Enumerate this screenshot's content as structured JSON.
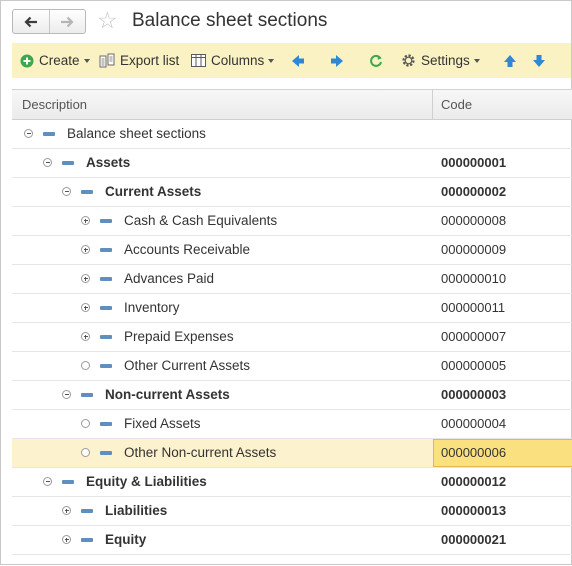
{
  "window": {
    "title": "Balance sheet sections"
  },
  "nav": {
    "back_icon": "arrow-left-icon",
    "forward_icon": "arrow-right-icon",
    "favorite_icon": "star-icon"
  },
  "toolbar": {
    "create_label": "Create",
    "export_label": "Export list",
    "columns_label": "Columns",
    "settings_label": "Settings",
    "colors": {
      "create": "#3aa84c",
      "arrows": "#2f87d6",
      "refresh": "#3aa84c"
    }
  },
  "table": {
    "columns": [
      "Description",
      "Code"
    ],
    "rows": [
      {
        "level": 0,
        "expander": "minus",
        "label": "Balance sheet sections",
        "code": "",
        "bold": false
      },
      {
        "level": 1,
        "expander": "minus",
        "label": "Assets",
        "code": "000000001",
        "bold": true
      },
      {
        "level": 2,
        "expander": "minus",
        "label": "Current Assets",
        "code": "000000002",
        "bold": true
      },
      {
        "level": 3,
        "expander": "plus",
        "label": "Cash & Cash Equivalents",
        "code": "000000008",
        "bold": false
      },
      {
        "level": 3,
        "expander": "plus",
        "label": "Accounts Receivable",
        "code": "000000009",
        "bold": false
      },
      {
        "level": 3,
        "expander": "plus",
        "label": "Advances Paid",
        "code": "000000010",
        "bold": false
      },
      {
        "level": 3,
        "expander": "plus",
        "label": "Inventory",
        "code": "000000011",
        "bold": false
      },
      {
        "level": 3,
        "expander": "plus",
        "label": "Prepaid Expenses",
        "code": "000000007",
        "bold": false
      },
      {
        "level": 3,
        "expander": "leaf",
        "label": "Other Current Assets",
        "code": "000000005",
        "bold": false
      },
      {
        "level": 2,
        "expander": "minus",
        "label": "Non-current Assets",
        "code": "000000003",
        "bold": true
      },
      {
        "level": 3,
        "expander": "leaf",
        "label": "Fixed Assets",
        "code": "000000004",
        "bold": false
      },
      {
        "level": 3,
        "expander": "leaf",
        "label": "Other Non-current Assets",
        "code": "000000006",
        "bold": false,
        "selected": true
      },
      {
        "level": 1,
        "expander": "minus",
        "label": "Equity & Liabilities",
        "code": "000000012",
        "bold": true
      },
      {
        "level": 2,
        "expander": "plus",
        "label": "Liabilities",
        "code": "000000013",
        "bold": true
      },
      {
        "level": 2,
        "expander": "plus",
        "label": "Equity",
        "code": "000000021",
        "bold": true
      }
    ]
  }
}
